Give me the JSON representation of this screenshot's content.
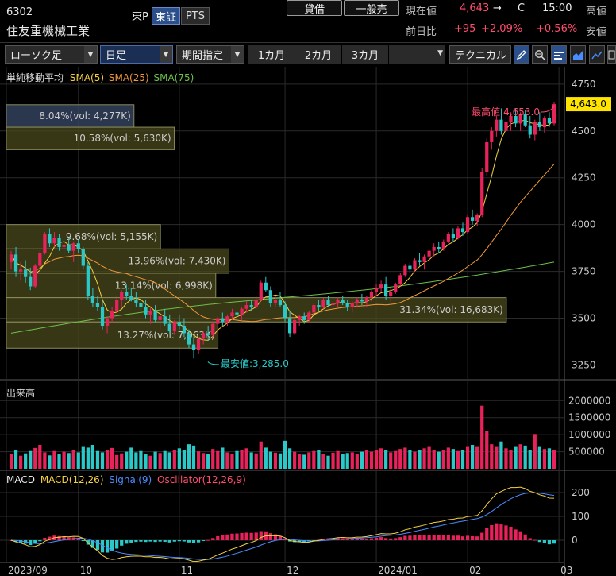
{
  "header": {
    "code": "6302",
    "name": "住友重機械工業",
    "market": "東P",
    "tabs": [
      "東証",
      "PTS"
    ],
    "loan_btn": "貸借",
    "sale_btn": "一般売",
    "cur_label": "現在値",
    "cur_val": "4,643",
    "cur_arrow": "→",
    "cur_flag": "C",
    "cur_time": "15:00",
    "high_label": "高値",
    "prev_label": "前日比",
    "prev_chg": "+95",
    "prev_pct": "+2.09%",
    "prev_pct2": "+0.56%",
    "low_label": "安値"
  },
  "toolbar": {
    "chart_type": "ローソク足",
    "period": "日足",
    "range": "期間指定",
    "ranges": [
      "1カ月",
      "2カ月",
      "3カ月"
    ],
    "technical": "テクニカル"
  },
  "main_chart": {
    "legend_title": "単純移動平均",
    "sma_labels": [
      "SMA(5)",
      "SMA(25)",
      "SMA(75)"
    ],
    "sma_colors": [
      "#f5d142",
      "#f29a3a",
      "#6cc04a"
    ],
    "up_color": "#e8225a",
    "down_color": "#2bc8c8",
    "price_ticks": [
      "4750",
      "4500",
      "4250",
      "4000",
      "3750",
      "3500",
      "3250"
    ],
    "price_tick_values": [
      4750,
      4500,
      4250,
      4000,
      3750,
      3500,
      3250
    ],
    "current_price": "4,643.0",
    "high_note": "最高値:4,653.0",
    "low_note": "最安値:3,285.0",
    "volume_profile": [
      {
        "text": "8.04%(vol: 4,277K)",
        "price_lo": 4520,
        "price_hi": 4640,
        "pct": 0.231,
        "color": "#3a4a6a"
      },
      {
        "text": "10.58%(vol: 5,630K)",
        "price_lo": 4400,
        "price_hi": 4520,
        "pct": 0.304,
        "color": "#4a4a1e"
      },
      {
        "text": "9.68%(vol: 5,155K)",
        "price_lo": 3870,
        "price_hi": 4000,
        "pct": 0.279,
        "color": "#4a4a1e"
      },
      {
        "text": "13.96%(vol: 7,430K)",
        "price_lo": 3740,
        "price_hi": 3870,
        "pct": 0.403,
        "color": "#4a4a1e"
      },
      {
        "text": "13.14%(vol: 6,998K)",
        "price_lo": 3610,
        "price_hi": 3740,
        "pct": 0.379,
        "color": "#4a4a1e"
      },
      {
        "text": "31.34%(vol: 16,683K)",
        "price_lo": 3480,
        "price_hi": 3610,
        "pct": 0.905,
        "color": "#4a4a1e"
      },
      {
        "text": "13.27%(vol: 7,063K)",
        "price_lo": 3340,
        "price_hi": 3480,
        "pct": 0.383,
        "color": "#4a4a1e"
      }
    ]
  },
  "volume_chart": {
    "title": "出来高",
    "ticks": [
      "2000000",
      "1500000",
      "1000000",
      "500000"
    ],
    "tick_values": [
      2000000,
      1500000,
      1000000,
      500000
    ]
  },
  "macd_chart": {
    "labels": [
      "MACD",
      "MACD(12,26)",
      "Signal(9)",
      "Oscillator(12,26,9)"
    ],
    "label_colors": [
      "#eeeeee",
      "#f5d142",
      "#4a8cff",
      "#ff4d6d"
    ],
    "ticks": [
      "200",
      "100",
      "0"
    ],
    "tick_values": [
      200,
      100,
      0
    ]
  },
  "x_axis": [
    "2023/09",
    "10",
    "11",
    "12",
    "2024/01",
    "02",
    "03"
  ],
  "x_axis_index": [
    0,
    15,
    36,
    58,
    77,
    96,
    115
  ],
  "chart_data": {
    "type": "candlestick",
    "title": "",
    "price_range": [
      3180,
      4830
    ],
    "ohlc": [
      [
        3800,
        3860,
        3760,
        3840
      ],
      [
        3840,
        3880,
        3720,
        3750
      ],
      [
        3750,
        3800,
        3700,
        3760
      ],
      [
        3760,
        3810,
        3690,
        3720
      ],
      [
        3720,
        3770,
        3650,
        3670
      ],
      [
        3670,
        3790,
        3660,
        3780
      ],
      [
        3780,
        3860,
        3770,
        3850
      ],
      [
        3850,
        3960,
        3840,
        3950
      ],
      [
        3950,
        3980,
        3880,
        3900
      ],
      [
        3900,
        3960,
        3880,
        3930
      ],
      [
        3930,
        3950,
        3860,
        3880
      ],
      [
        3880,
        3920,
        3840,
        3890
      ],
      [
        3890,
        3930,
        3850,
        3860
      ],
      [
        3860,
        3910,
        3800,
        3900
      ],
      [
        3900,
        3920,
        3850,
        3870
      ],
      [
        3870,
        3880,
        3760,
        3780
      ],
      [
        3780,
        3800,
        3600,
        3620
      ],
      [
        3620,
        3660,
        3560,
        3580
      ],
      [
        3580,
        3620,
        3540,
        3560
      ],
      [
        3560,
        3600,
        3440,
        3460
      ],
      [
        3460,
        3510,
        3420,
        3500
      ],
      [
        3500,
        3560,
        3480,
        3540
      ],
      [
        3540,
        3620,
        3530,
        3600
      ],
      [
        3600,
        3650,
        3560,
        3640
      ],
      [
        3640,
        3680,
        3600,
        3620
      ],
      [
        3620,
        3660,
        3590,
        3600
      ],
      [
        3600,
        3640,
        3560,
        3580
      ],
      [
        3580,
        3620,
        3540,
        3560
      ],
      [
        3560,
        3600,
        3500,
        3520
      ],
      [
        3520,
        3560,
        3470,
        3540
      ],
      [
        3540,
        3570,
        3480,
        3490
      ],
      [
        3490,
        3530,
        3440,
        3510
      ],
      [
        3510,
        3550,
        3460,
        3470
      ],
      [
        3470,
        3520,
        3420,
        3430
      ],
      [
        3430,
        3490,
        3410,
        3480
      ],
      [
        3480,
        3520,
        3440,
        3460
      ],
      [
        3460,
        3500,
        3400,
        3420
      ],
      [
        3420,
        3440,
        3340,
        3360
      ],
      [
        3360,
        3400,
        3285,
        3330
      ],
      [
        3330,
        3400,
        3310,
        3390
      ],
      [
        3390,
        3430,
        3360,
        3420
      ],
      [
        3420,
        3460,
        3380,
        3410
      ],
      [
        3410,
        3480,
        3400,
        3470
      ],
      [
        3470,
        3510,
        3440,
        3500
      ],
      [
        3500,
        3530,
        3460,
        3480
      ],
      [
        3480,
        3520,
        3460,
        3510
      ],
      [
        3510,
        3550,
        3490,
        3530
      ],
      [
        3530,
        3560,
        3500,
        3520
      ],
      [
        3520,
        3560,
        3490,
        3550
      ],
      [
        3550,
        3590,
        3530,
        3570
      ],
      [
        3570,
        3600,
        3540,
        3560
      ],
      [
        3560,
        3620,
        3550,
        3600
      ],
      [
        3600,
        3700,
        3590,
        3690
      ],
      [
        3690,
        3720,
        3640,
        3650
      ],
      [
        3650,
        3670,
        3560,
        3580
      ],
      [
        3580,
        3620,
        3560,
        3600
      ],
      [
        3600,
        3640,
        3560,
        3570
      ],
      [
        3570,
        3590,
        3480,
        3500
      ],
      [
        3500,
        3540,
        3400,
        3420
      ],
      [
        3420,
        3500,
        3410,
        3490
      ],
      [
        3490,
        3520,
        3460,
        3510
      ],
      [
        3510,
        3530,
        3470,
        3490
      ],
      [
        3490,
        3540,
        3480,
        3530
      ],
      [
        3530,
        3580,
        3520,
        3570
      ],
      [
        3570,
        3600,
        3540,
        3560
      ],
      [
        3560,
        3610,
        3550,
        3600
      ],
      [
        3600,
        3620,
        3560,
        3570
      ],
      [
        3570,
        3590,
        3540,
        3580
      ],
      [
        3580,
        3610,
        3560,
        3600
      ],
      [
        3600,
        3620,
        3570,
        3580
      ],
      [
        3580,
        3600,
        3540,
        3560
      ],
      [
        3560,
        3590,
        3530,
        3580
      ],
      [
        3580,
        3610,
        3560,
        3600
      ],
      [
        3600,
        3630,
        3570,
        3590
      ],
      [
        3590,
        3620,
        3560,
        3610
      ],
      [
        3610,
        3650,
        3590,
        3640
      ],
      [
        3640,
        3680,
        3620,
        3660
      ],
      [
        3660,
        3700,
        3640,
        3680
      ],
      [
        3680,
        3720,
        3600,
        3620
      ],
      [
        3620,
        3660,
        3590,
        3640
      ],
      [
        3640,
        3690,
        3630,
        3680
      ],
      [
        3680,
        3740,
        3670,
        3730
      ],
      [
        3730,
        3790,
        3720,
        3780
      ],
      [
        3780,
        3800,
        3740,
        3760
      ],
      [
        3760,
        3820,
        3750,
        3810
      ],
      [
        3810,
        3850,
        3780,
        3800
      ],
      [
        3800,
        3840,
        3760,
        3830
      ],
      [
        3830,
        3870,
        3800,
        3860
      ],
      [
        3860,
        3900,
        3830,
        3880
      ],
      [
        3880,
        3910,
        3850,
        3870
      ],
      [
        3870,
        3920,
        3860,
        3910
      ],
      [
        3910,
        3960,
        3900,
        3950
      ],
      [
        3950,
        3980,
        3910,
        3930
      ],
      [
        3930,
        3990,
        3920,
        3980
      ],
      [
        3980,
        4010,
        3940,
        3960
      ],
      [
        3960,
        4050,
        3950,
        4040
      ],
      [
        4040,
        4080,
        4000,
        4020
      ],
      [
        4020,
        4060,
        3990,
        4050
      ],
      [
        4050,
        4300,
        4040,
        4280
      ],
      [
        4280,
        4460,
        4260,
        4440
      ],
      [
        4440,
        4520,
        4400,
        4500
      ],
      [
        4500,
        4580,
        4470,
        4560
      ],
      [
        4560,
        4620,
        4480,
        4500
      ],
      [
        4500,
        4580,
        4460,
        4550
      ],
      [
        4550,
        4600,
        4500,
        4580
      ],
      [
        4580,
        4620,
        4520,
        4540
      ],
      [
        4540,
        4600,
        4500,
        4590
      ],
      [
        4590,
        4610,
        4520,
        4530
      ],
      [
        4530,
        4580,
        4460,
        4480
      ],
      [
        4480,
        4560,
        4450,
        4550
      ],
      [
        4550,
        4600,
        4500,
        4520
      ],
      [
        4520,
        4580,
        4490,
        4570
      ],
      [
        4570,
        4600,
        4520,
        4540
      ],
      [
        4540,
        4653,
        4530,
        4643
      ]
    ],
    "volume": [
      420000,
      560000,
      380000,
      450000,
      520000,
      610000,
      700000,
      480000,
      390000,
      520000,
      440000,
      500000,
      460000,
      550000,
      480000,
      640000,
      620000,
      700000,
      520000,
      480000,
      560000,
      610000,
      400000,
      450000,
      500000,
      620000,
      480000,
      520000,
      440000,
      380000,
      500000,
      460000,
      520000,
      480000,
      540000,
      600000,
      560000,
      720000,
      680000,
      510000,
      460000,
      430000,
      580000,
      520000,
      620000,
      480000,
      440000,
      520000,
      560000,
      600000,
      480000,
      450000,
      800000,
      620000,
      500000,
      470000,
      450000,
      820000,
      600000,
      500000,
      440000,
      410000,
      480000,
      520000,
      560000,
      430000,
      380000,
      470000,
      520000,
      440000,
      460000,
      480000,
      420000,
      500000,
      540000,
      500000,
      560000,
      600000,
      540000,
      480000,
      520000,
      580000,
      620000,
      560000,
      500000,
      540000,
      600000,
      640000,
      560000,
      500000,
      540000,
      620000,
      580000,
      520000,
      560000,
      640000,
      700000,
      640000,
      1850000,
      1100000,
      720000,
      640000,
      800000,
      600000,
      560000,
      640000,
      720000,
      680000,
      560000,
      1020000,
      640000,
      580000,
      600000,
      560000
    ],
    "sma5": [],
    "macd": [],
    "signal": [],
    "osc": []
  }
}
